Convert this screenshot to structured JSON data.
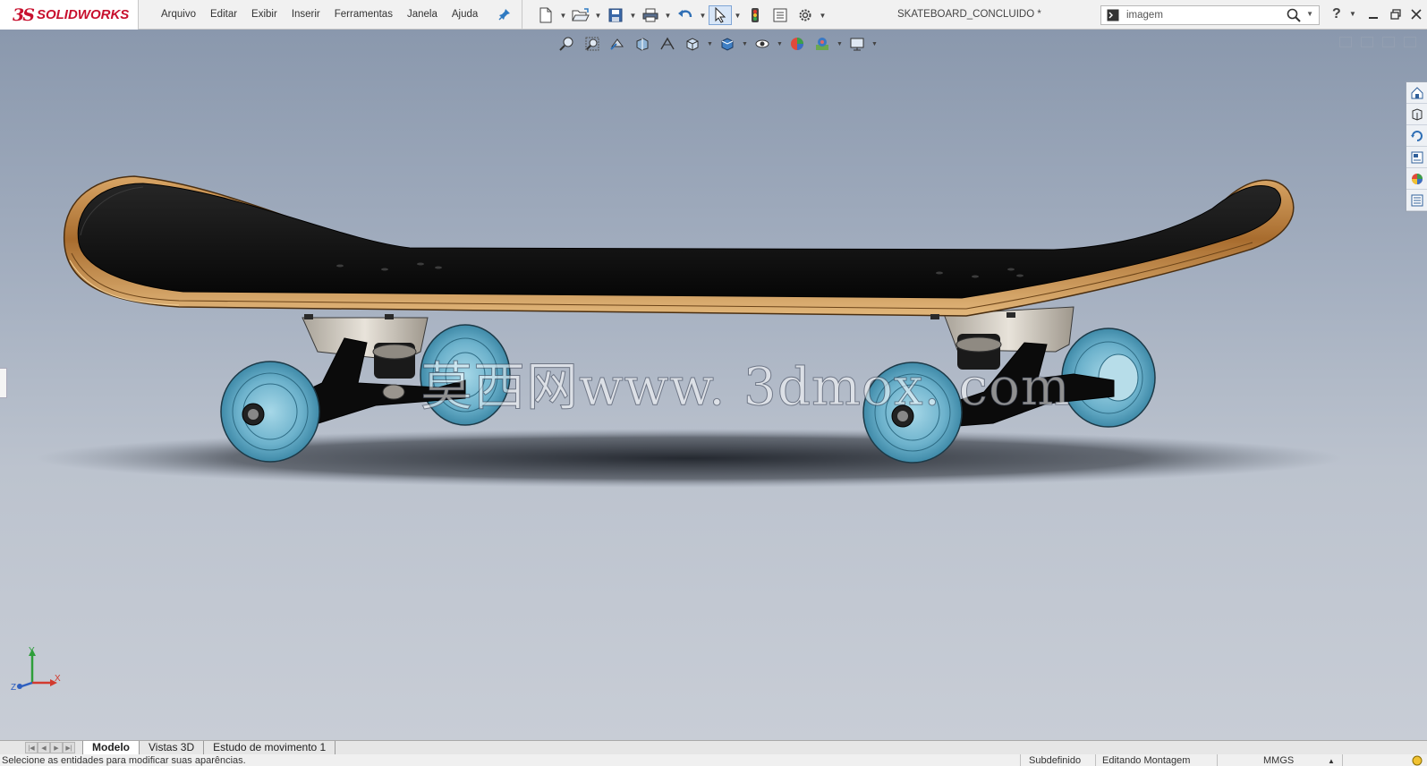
{
  "app": {
    "brand_prefix": "3S",
    "brand_name": "SOLIDWORKS"
  },
  "menu": [
    {
      "label": "Arquivo"
    },
    {
      "label": "Editar"
    },
    {
      "label": "Exibir"
    },
    {
      "label": "Inserir"
    },
    {
      "label": "Ferramentas"
    },
    {
      "label": "Janela"
    },
    {
      "label": "Ajuda"
    }
  ],
  "document": {
    "title": "SKATEBOARD_CONCLUIDO *"
  },
  "search": {
    "value": "imagem",
    "placeholder": "imagem"
  },
  "help": {
    "label": "?"
  },
  "viewport": {
    "watermark": "莫西网www. 3dmox. com",
    "triad": {
      "y": "Y",
      "x": "X",
      "z": "Z"
    }
  },
  "colors": {
    "accent": "#c8102e",
    "deck_grip": "#0e0e0e",
    "deck_wood": "#b07a3a",
    "wheel": "#5fa9c6",
    "truck": "#0a0a0a",
    "baseplate": "#cdc7be"
  },
  "bottom_tabs": [
    {
      "label": "Modelo",
      "active": true
    },
    {
      "label": "Vistas 3D",
      "active": false
    },
    {
      "label": "Estudo de movimento 1",
      "active": false
    }
  ],
  "status": {
    "message": "Selecione as entidades para modificar suas aparências.",
    "definition": "Subdefinido",
    "mode": "Editando Montagem",
    "units": "MMGS"
  }
}
